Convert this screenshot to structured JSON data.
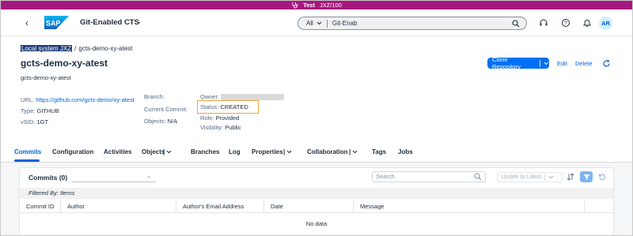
{
  "env_banner": {
    "label": "Test",
    "system": "JXZ/100"
  },
  "shell": {
    "app_title": "Git-Enabled CTS",
    "search_scope": "All",
    "search_value": "Git-Enab",
    "avatar_initials": "AR"
  },
  "breadcrumb": {
    "link": "Local system JXZ",
    "separator": "/",
    "current": "gcts-demo-xy-atest"
  },
  "object": {
    "title": "gcts-demo-xy-atest",
    "subtitle": "gcts-demo-xy-atest",
    "clone_label": "Clone Repository",
    "edit_label": "Edit",
    "delete_label": "Delete"
  },
  "facets": {
    "url_label": "URL:",
    "url_value": "https://github.com/gcts-demo/xy-atest",
    "type_label": "Type:",
    "type_value": "GITHUB",
    "vsid_label": "vSID:",
    "vsid_value": "1GT",
    "branch_label": "Branch:",
    "commit_label": "Current Commit:",
    "objects_label": "Objects:",
    "objects_value": "N/A",
    "owner_label": "Owner:",
    "status_label": "Status:",
    "status_value": "CREATED",
    "role_label": "Role:",
    "role_value": "Provided",
    "visibility_label": "Visibility:",
    "visibility_value": "Public"
  },
  "tabs": [
    "Commits",
    "Configuration",
    "Activities",
    "Objects",
    "Branches",
    "Log",
    "Properties",
    "Collaboration",
    "Tags",
    "Jobs"
  ],
  "table": {
    "title": "Commits (0)",
    "search_placeholder": "Search",
    "update_label": "Update to Latest",
    "filtered_by": "Filtered By: Items",
    "columns": [
      "Commit ID",
      "Author",
      "Author's Email Address",
      "Date",
      "Message"
    ],
    "empty_text": "No data"
  },
  "colors": {
    "banner": "#a5187e",
    "primary": "#0070f2",
    "link": "#0064d9",
    "highlight": "#e9a43f"
  }
}
